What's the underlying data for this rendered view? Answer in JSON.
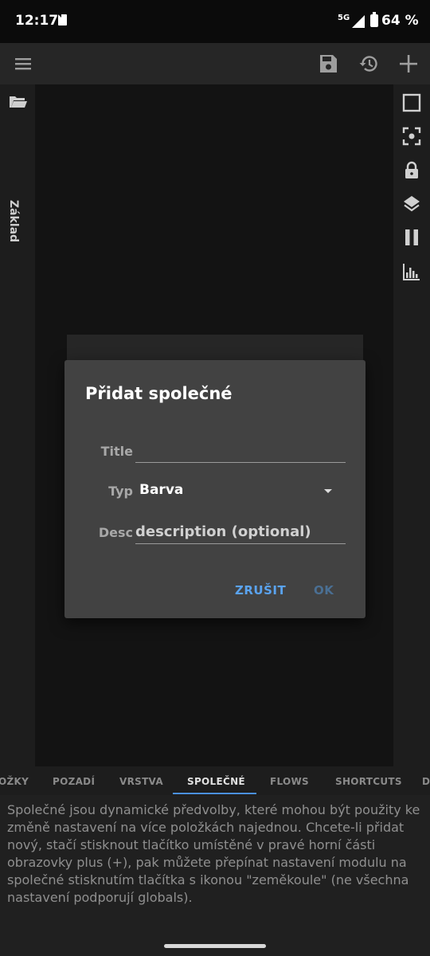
{
  "status_bar": {
    "time": "12:17",
    "network": "5G",
    "battery": "64 %"
  },
  "toolbar": {
    "menu_icon": "menu-icon",
    "save_icon": "save-icon",
    "history_icon": "history-icon",
    "add_icon": "plus-icon"
  },
  "left_sidebar": {
    "folder_icon": "folder-open-icon",
    "label": "Základ"
  },
  "right_sidebar": {
    "icons": [
      "square-icon",
      "focus-icon",
      "lock-icon",
      "layers-icon",
      "pause-icon",
      "histogram-icon"
    ]
  },
  "tabs": [
    {
      "label": "OŽKY"
    },
    {
      "label": "POZADÍ"
    },
    {
      "label": "VRSTVA"
    },
    {
      "label": "SPOLEČNÉ",
      "active": true
    },
    {
      "label": "FLOWS"
    },
    {
      "label": "SHORTCUTS"
    },
    {
      "label": "D"
    }
  ],
  "info_text": "Společné jsou dynamické předvolby, které mohou být použity ke změně nastavení na více položkách najednou. Chcete-li přidat nový, stačí stisknout tlačítko umístěné v pravé horní části obrazovky plus (+), pak můžete přepínat nastavení modulu na společné stisknutím tlačítka s ikonou \"zeměkoule\" (ne všechna nastavení podporují globals).",
  "dialog": {
    "title": "Přidat společné",
    "title_label": "Title",
    "title_value": "",
    "typ_label": "Typ",
    "typ_value": "Barva",
    "desc_label": "Desc",
    "desc_placeholder": "description (optional)",
    "cancel_label": "ZRUŠIT",
    "ok_label": "OK"
  },
  "colors": {
    "accent": "#5aa3f0",
    "ok_disabled": "#4a6f93",
    "dialog_bg": "#424242"
  }
}
